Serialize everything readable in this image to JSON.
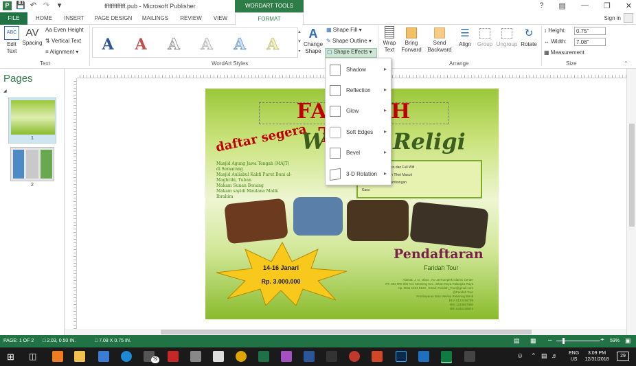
{
  "window": {
    "title": "fffffffffffff.pub - Microsoft Publisher",
    "tools_header": "WORDART TOOLS",
    "sign_in": "Sign in",
    "help": "?"
  },
  "tabs": [
    "FILE",
    "HOME",
    "INSERT",
    "PAGE DESIGN",
    "MAILINGS",
    "REVIEW",
    "VIEW",
    "FORMAT"
  ],
  "ribbon": {
    "text_group": {
      "label": "Text",
      "edit_text": "Edit\nText",
      "spacing": "Spacing",
      "even_height": "Even Height",
      "vertical_text": "Vertical Text",
      "alignment": "Alignment"
    },
    "wordart_group": {
      "label": "WordArt Styles",
      "change_shape": "Change\nShape"
    },
    "shape_buttons": {
      "fill": "Shape Fill",
      "outline": "Shape Outline",
      "effects": "Shape Effects"
    },
    "arrange_group": {
      "label": "Arrange",
      "wrap": "Wrap\nText",
      "bring": "Bring\nForward",
      "send": "Send\nBackward",
      "align": "Align",
      "group": "Group",
      "ungroup": "Ungroup",
      "rotate": "Rotate"
    },
    "size_group": {
      "label": "Size",
      "height_label": "Height:",
      "height_value": "0.75\"",
      "width_label": "Width:",
      "width_value": "7.08\"",
      "measurement": "Measurement"
    }
  },
  "effects_menu": [
    "Shadow",
    "Reflection",
    "Glow",
    "Soft Edges",
    "Bevel",
    "3-D Rotation"
  ],
  "pages": {
    "title": "Pages",
    "items": [
      "1",
      "2"
    ]
  },
  "poster": {
    "title": "FARIDAH TOUR",
    "subtitle": "Wisata Religi",
    "daftar": "daftar segera",
    "bullets": [
      "Masjid Agung Jawa Tengah (MAJT) di Semarang",
      "Masjid Auliabul Kahfi Purut Buni al-Maghribi, Tuban",
      "Makam Sunan Bonang",
      "Makam sayidi Maulana Malik Ibrahim"
    ],
    "facility_lines": [
      "Bus AC, Audio, Video dan Full Wifi",
      "Souvenir Cantik dan Tiket Masuk",
      "Makan Bersama Rombongan",
      "Kaos"
    ],
    "date": "14-16 Janari",
    "price": "Rp. 3.000.000",
    "pendaftaran": "Pendaftaran",
    "org": "Faridah Tour",
    "address": [
      "Alamat: J. G. Obos , No 18 Komplek Islamic Center",
      "RT. 002 RW 006 Kel. Menteng Kec. Jekan Raya Palangka Raya",
      "Hp. 0811 1234 5123 , Email. Faridah_Tour@gmail.com",
      "@Faridah Tour",
      "Pembayaran Bisa Melalui Rekening Bank",
      "BCA 0123456789",
      "BNI 1234567890",
      "BRI 5432109876"
    ]
  },
  "status": {
    "page": "PAGE: 1 OF 2",
    "position": "2.03, 0.50 IN.",
    "size": "7.08 X 0.75 IN.",
    "zoom": "59%"
  },
  "taskbar": {
    "lang": "ENG",
    "region": "US",
    "time": "3:09 PM",
    "date": "12/31/2018",
    "notif": "29",
    "badge": "79"
  }
}
